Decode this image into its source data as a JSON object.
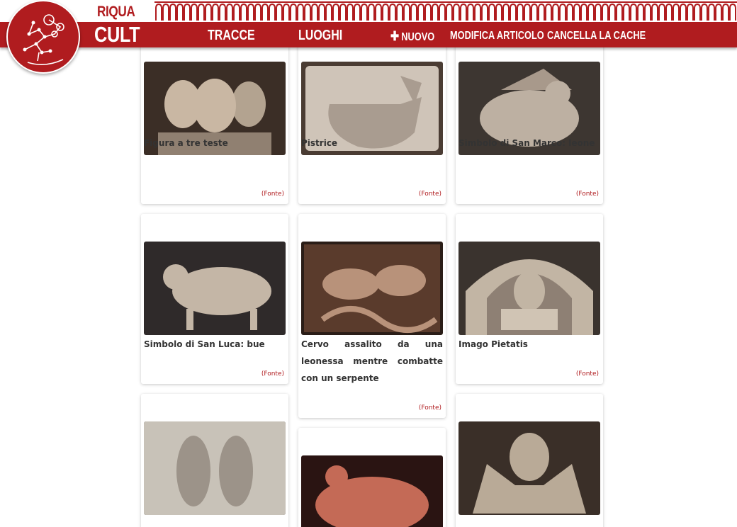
{
  "brand": {
    "top": "RIQUA",
    "bottom": "CULT",
    "logo_icon": "constellation-logo-icon"
  },
  "nav": {
    "tracce": "TRACCE",
    "luoghi": "LUOGHI",
    "nuovo": "NUOVO",
    "plus_icon": "plus-icon",
    "modifica": "MODIFICA ARTICOLO",
    "cancella": "CANCELLA LA CACHE"
  },
  "colors": {
    "brand_red": "#b01c1f",
    "text": "#333333"
  },
  "cards": [
    {
      "title": "Figura a tre teste",
      "source": "(Fonte)",
      "image": "three-headed-figure-relief"
    },
    {
      "title": "Pistrice",
      "source": "(Fonte)",
      "image": "pistrice-relief"
    },
    {
      "title": "Simbolo di San Marco: leone",
      "source": "(Fonte)",
      "image": "winged-lion-relief"
    },
    {
      "title": "Simbolo di San Luca: bue",
      "source": "(Fonte)",
      "image": "winged-ox-relief"
    },
    {
      "title": "Cervo assalito da una leonessa mentre combatte con un serpente",
      "source": "(Fonte)",
      "image": "deer-lioness-relief"
    },
    {
      "title": "Imago Pietatis",
      "source": "(Fonte)",
      "image": "imago-pietatis-relief"
    },
    {
      "title": "",
      "source": "",
      "image": "two-warriors-relief"
    },
    {
      "title": "",
      "source": "",
      "image": "red-eagle-relief"
    },
    {
      "title": "",
      "source": "",
      "image": "angel-relief"
    }
  ]
}
